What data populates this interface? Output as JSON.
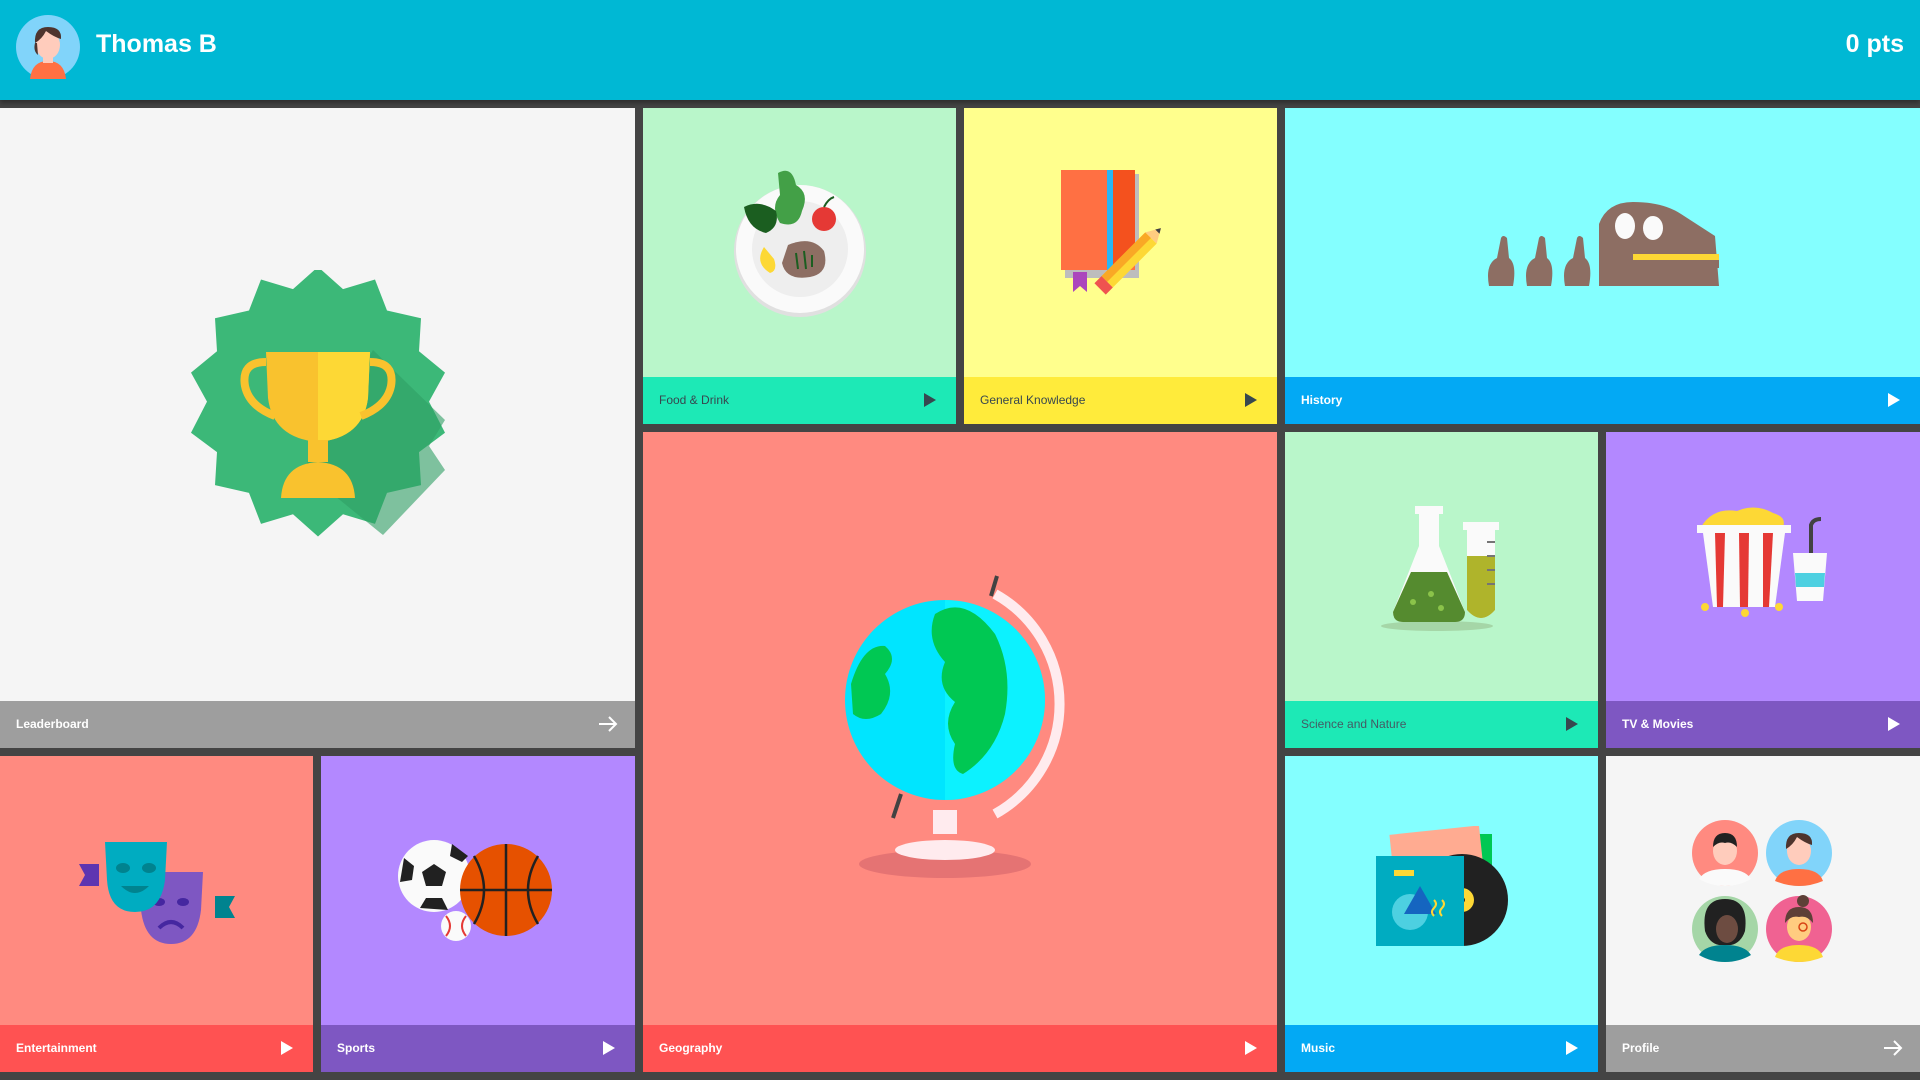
{
  "header": {
    "username": "Thomas B",
    "points": "0 pts"
  },
  "tiles": {
    "leaderboard": {
      "label": "Leaderboard",
      "icon": "trophy-icon",
      "bg": "#F5F5F5",
      "bar": "#9E9E9E"
    },
    "food": {
      "label": "Food & Drink",
      "icon": "plate-icon",
      "bg": "#B9F6CA",
      "bar": "#1DE9B6"
    },
    "general": {
      "label": "General Knowledge",
      "icon": "book-pencil-icon",
      "bg": "#FFFF8D",
      "bar": "#FFEB3B"
    },
    "history": {
      "label": "History",
      "icon": "dinosaur-skull-icon",
      "bg": "#84FFFF",
      "bar": "#03A9F4"
    },
    "geography": {
      "label": "Geography",
      "icon": "globe-icon",
      "bg": "#FF8A80",
      "bar": "#FF5252"
    },
    "science": {
      "label": "Science and Nature",
      "icon": "flask-icon",
      "bg": "#B9F6CA",
      "bar": "#1DE9B6"
    },
    "tv": {
      "label": "TV & Movies",
      "icon": "popcorn-icon",
      "bg": "#B388FF",
      "bar": "#7E57C2"
    },
    "entertainment": {
      "label": "Entertainment",
      "icon": "theater-masks-icon",
      "bg": "#FF8A80",
      "bar": "#FF5252"
    },
    "sports": {
      "label": "Sports",
      "icon": "balls-icon",
      "bg": "#B388FF",
      "bar": "#7E57C2"
    },
    "music": {
      "label": "Music",
      "icon": "vinyl-record-icon",
      "bg": "#84FFFF",
      "bar": "#03A9F4"
    },
    "profile": {
      "label": "Profile",
      "icon": "avatars-icon",
      "bg": "#F5F5F5",
      "bar": "#9E9E9E"
    }
  }
}
